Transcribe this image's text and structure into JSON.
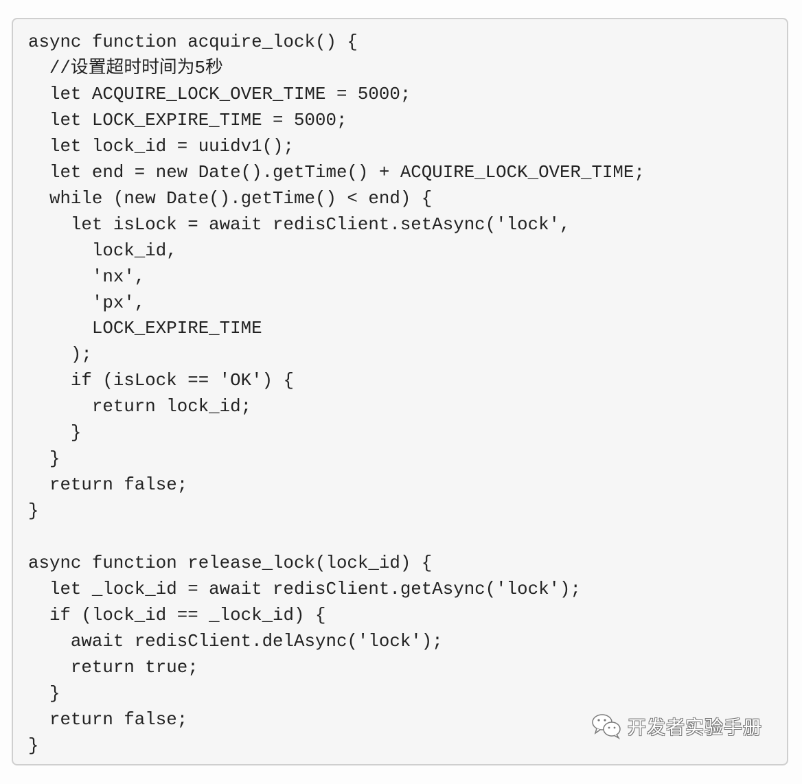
{
  "code_block": {
    "language": "javascript",
    "lines": [
      "async function acquire_lock() {",
      "  //设置超时时间为5秒",
      "  let ACQUIRE_LOCK_OVER_TIME = 5000;",
      "  let LOCK_EXPIRE_TIME = 5000;",
      "  let lock_id = uuidv1();",
      "  let end = new Date().getTime() + ACQUIRE_LOCK_OVER_TIME;",
      "  while (new Date().getTime() < end) {",
      "    let isLock = await redisClient.setAsync('lock',",
      "      lock_id,",
      "      'nx',",
      "      'px',",
      "      LOCK_EXPIRE_TIME",
      "    );",
      "    if (isLock == 'OK') {",
      "      return lock_id;",
      "    }",
      "  }",
      "  return false;",
      "}",
      "",
      "async function release_lock(lock_id) {",
      "  let _lock_id = await redisClient.getAsync('lock');",
      "  if (lock_id == _lock_id) {",
      "    await redisClient.delAsync('lock');",
      "    return true;",
      "  }",
      "  return false;",
      "}"
    ]
  },
  "watermark": {
    "icon": "wechat-icon",
    "text": "开发者实验手册"
  }
}
